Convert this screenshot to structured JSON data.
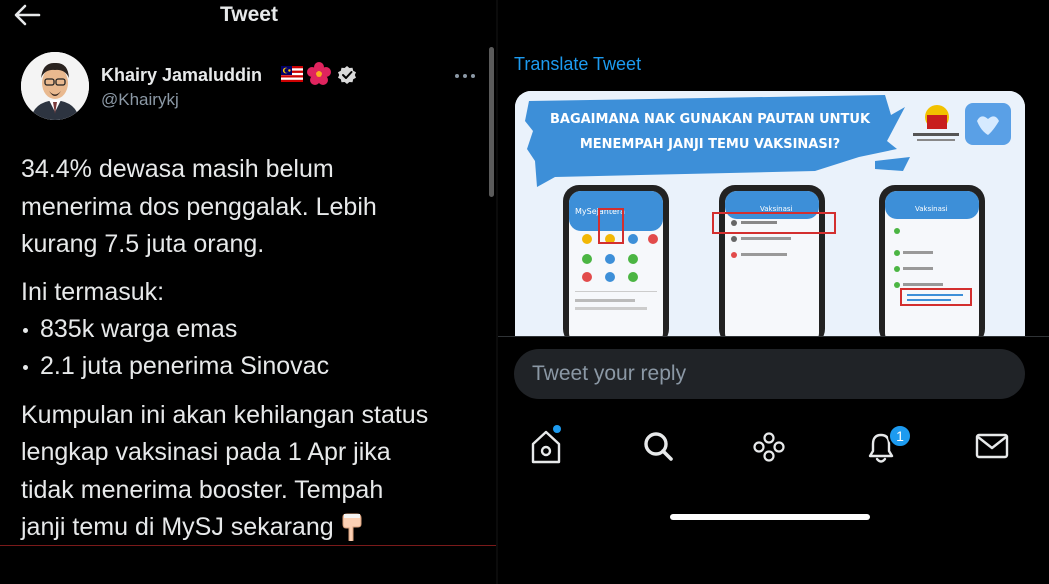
{
  "header": {
    "title": "Tweet",
    "back_icon": "arrow-left-icon"
  },
  "author": {
    "name": "Khairy Jamaluddin",
    "handle": "@Khairykj",
    "badges": [
      "malaysia-flag-icon",
      "hibiscus-icon",
      "verified-icon"
    ]
  },
  "tweet": {
    "lines": [
      "34.4% dewasa masih belum",
      "menerima dos penggalak. Lebih",
      "kurang 7.5 juta orang.",
      "Ini termasuk:",
      "835k warga emas",
      "2.1 juta penerima Sinovac",
      "Kumpulan ini akan kehilangan status",
      "lengkap vaksinasi pada 1 Apr jika",
      "tidak menerima booster. Tempah",
      "janji temu di MySJ sekarang"
    ]
  },
  "translate": {
    "label": "Translate Tweet"
  },
  "media": {
    "headline_line1": "BAGAIMANA NAK GUNAKAN PAUTAN UNTUK",
    "headline_line2": "MENEMPAH JANJI TEMU VAKSINASI?",
    "phone1_title": "MySejahtera",
    "phone2_title": "Vaksinasi",
    "phone3_title": "Vaksinasi"
  },
  "reply": {
    "placeholder": "Tweet your reply"
  },
  "nav": {
    "items": [
      "home-icon",
      "search-icon",
      "spaces-icon",
      "notifications-icon",
      "messages-icon"
    ],
    "notification_count": "1"
  },
  "colors": {
    "accent": "#1d9bf0",
    "background": "#000000",
    "text": "#e7e9ea",
    "muted": "#8b98a5"
  }
}
